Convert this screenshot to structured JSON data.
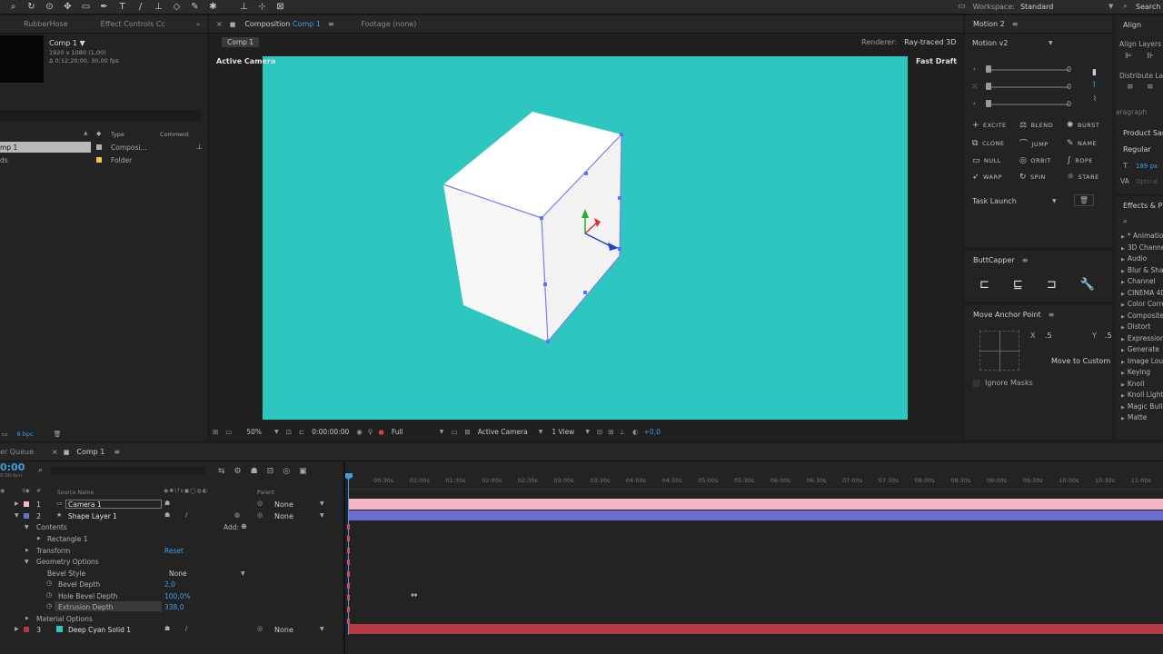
{
  "topbar": {
    "workspace_label": "Workspace:",
    "workspace_value": "Standard",
    "search": "Search"
  },
  "project": {
    "tabs": [
      "RubberHose",
      "Effect Controls Cc"
    ],
    "comp_name": "Comp 1 ▼",
    "comp_info1": "1920 x 1080 (1,00)",
    "comp_info2": "Δ 0;12;20;00, 30,00 fps",
    "col_type": "Type",
    "col_comment": "Comment",
    "items": [
      {
        "name": "mp 1",
        "type": "Composi..."
      },
      {
        "name": "ds",
        "type": "Folder"
      }
    ],
    "bpc": "8 bpc"
  },
  "comp": {
    "tab_label": "Composition",
    "tab_name": "Comp 1",
    "footage_tab": "Footage (none)",
    "subtab": "Comp 1",
    "renderer_label": "Renderer:",
    "renderer_value": "Ray-traced 3D",
    "active_camera": "Active Camera",
    "fast_draft": "Fast Draft",
    "bg_color": "#2ec7bf",
    "zoom": "50%",
    "timecode": "0:00:00:00",
    "resolution": "Full",
    "view": "Active Camera",
    "views": "1 View",
    "exposure": "+0,0"
  },
  "motion": {
    "title": "Motion 2",
    "dropdown": "Motion v2",
    "sliders": [
      "0",
      "0",
      "0"
    ],
    "buttons": [
      [
        "EXCITE",
        "BLEND",
        "BURST"
      ],
      [
        "CLONE",
        "JUMP",
        "NAME"
      ],
      [
        "NULL",
        "ORBIT",
        "ROPE"
      ],
      [
        "WARP",
        "SPIN",
        "STARE"
      ]
    ],
    "task": "Task Launch"
  },
  "buttcapper": {
    "title": "ButtCapper"
  },
  "anchor": {
    "title": "Move Anchor Point",
    "x_label": "X",
    "x_value": ".5",
    "y_label": "Y",
    "y_value": ".5",
    "move_btn": "Move to Custom",
    "ignore": "Ignore Masks"
  },
  "align": {
    "title": "Align",
    "align_layers": "Align Layers",
    "distribute": "Distribute La",
    "paragraph": "aragraph",
    "product": "Product San",
    "regular": "Regular",
    "size": "189 px",
    "optical": "Optical"
  },
  "effects": {
    "title": "Effects & Pr",
    "items": [
      "* Animation",
      "3D Channel",
      "Audio",
      "Blur & Shar",
      "Channel",
      "CINEMA 4D",
      "Color Corre",
      "Composite",
      "Distort",
      "Expression",
      "Generate",
      "Image Lou",
      "Keying",
      "Knoll",
      "Knoll Light",
      "Magic Bulle",
      "Matte"
    ]
  },
  "timeline": {
    "queue_tab": "er Queue",
    "comp_tab": "Comp 1",
    "timecode": "0:00",
    "fps": "0.00 fps)",
    "col_source": "Source Name",
    "col_parent": "Parent",
    "ruler": [
      "00:30s",
      "01:00s",
      "01:30s",
      "02:00s",
      "02:30s",
      "03:00s",
      "03:30s",
      "04:00s",
      "04:30s",
      "05:00s",
      "05:30s",
      "06:00s",
      "06:30s",
      "07:00s",
      "07:30s",
      "08:00s",
      "08:30s",
      "09:00s",
      "09:30s",
      "10:00s",
      "10:30s",
      "11:00s"
    ],
    "layers": [
      {
        "num": "1",
        "name": "Camera 1",
        "parent": "None"
      },
      {
        "num": "2",
        "name": "Shape Layer 1",
        "parent": "None"
      },
      {
        "num": "3",
        "name": "Deep Cyan Solid 1",
        "parent": "None"
      }
    ],
    "contents": "Contents",
    "add": "Add:",
    "rectangle": "Rectangle 1",
    "transform": "Transform",
    "reset": "Reset",
    "geometry": "Geometry Options",
    "bevel_style": "Bevel Style",
    "bevel_style_value": "None",
    "bevel_depth": "Bevel Depth",
    "bevel_depth_value": "2,0",
    "hole_bevel": "Hole Bevel Depth",
    "hole_bevel_value": "100,0%",
    "extrusion": "Extrusion Depth",
    "extrusion_value": "338,0",
    "material": "Material Options"
  }
}
